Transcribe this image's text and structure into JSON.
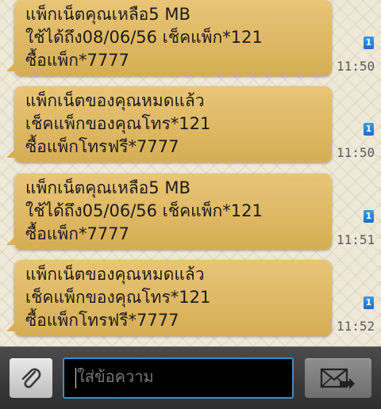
{
  "messages": [
    {
      "lines": [
        "แพ็กเน็ตคุณเหลือ5 MB",
        "ใช้ได้ถึง08/06/56 เช็คแพ็ก*121",
        "ซื้อแพ็ก*7777"
      ],
      "badge": "1",
      "time": "11:50"
    },
    {
      "lines": [
        "แพ็กเน็ตของคุณหมดแล้ว",
        "เช็คแพ็กของคุณโทร*121",
        "ซื้อแพ็กโทรฟรี*7777"
      ],
      "badge": "1",
      "time": "11:50"
    },
    {
      "lines": [
        "แพ็กเน็ตคุณเหลือ5 MB",
        "ใช้ได้ถึง05/06/56 เช็คแพ็ก*121",
        "ซื้อแพ็ก*7777"
      ],
      "badge": "1",
      "time": "11:51"
    },
    {
      "lines": [
        "แพ็กเน็ตของคุณหมดแล้ว",
        "เช็คแพ็กของคุณโทร*121",
        "ซื้อแพ็กโทรฟรี*7777"
      ],
      "badge": "1",
      "time": "11:52"
    }
  ],
  "composer": {
    "placeholder": "ใส่ข้อความ",
    "attach_icon": "paperclip-icon",
    "send_icon": "send-message-icon"
  },
  "colors": {
    "bubble": "#dfb966",
    "input_border": "#3a8fc7",
    "badge": "#2a7fd4"
  }
}
